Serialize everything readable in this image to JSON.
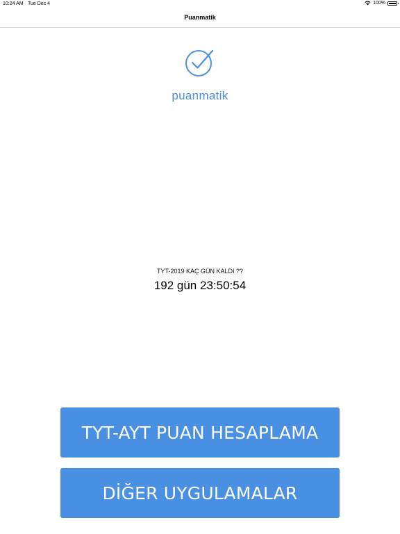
{
  "status_bar": {
    "time": "10:24 AM",
    "date": "Tue Dec 4",
    "battery": "100%"
  },
  "nav": {
    "title": "Puanmatik"
  },
  "logo": {
    "icon": "check-circle-icon",
    "brand_text": "puanmatik",
    "color": "#4a90e2"
  },
  "countdown": {
    "label": "TYT-2019 KAÇ GÜN KALDI ??",
    "value": "192 gün 23:50:54"
  },
  "buttons": {
    "primary_label": "TYT-AYT PUAN HESAPLAMA",
    "secondary_label": "DİĞER UYGULAMALAR",
    "color": "#4a90e2"
  }
}
